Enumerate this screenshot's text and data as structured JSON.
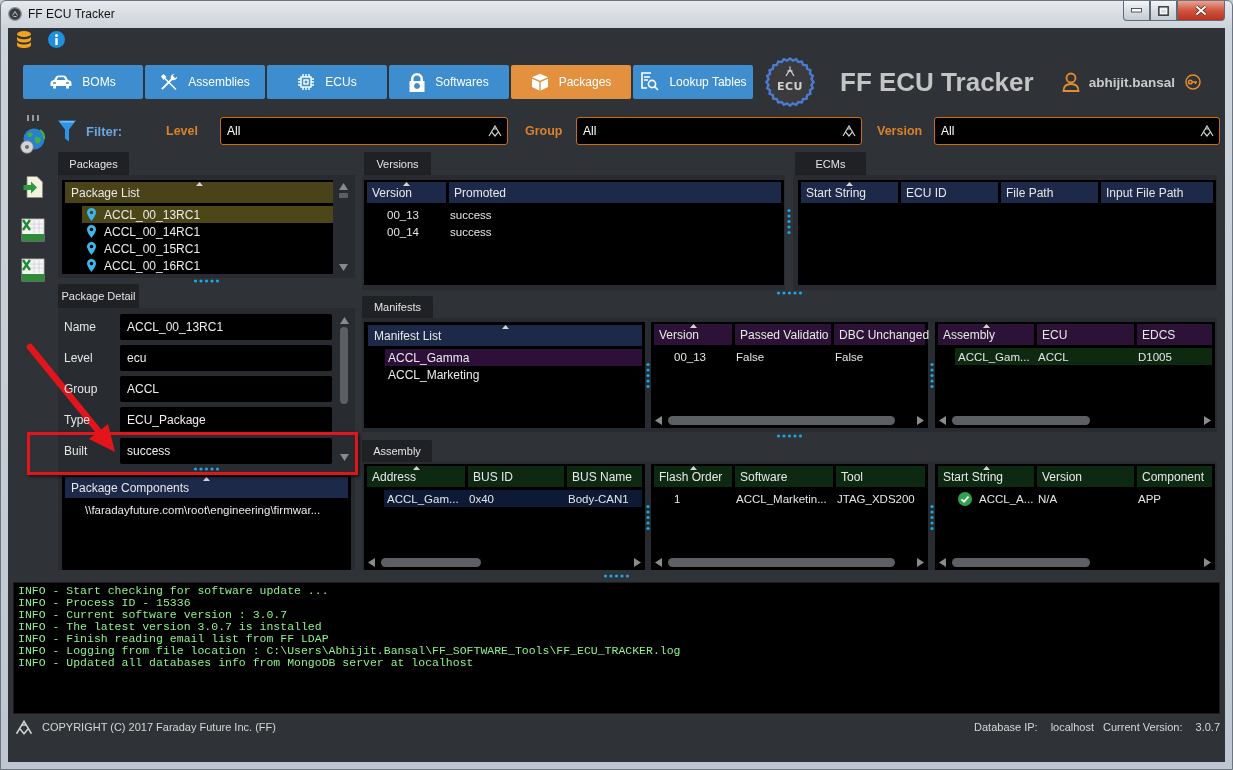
{
  "window": {
    "title": "FF ECU Tracker"
  },
  "nav_tabs": [
    {
      "label": "BOMs",
      "selected": false
    },
    {
      "label": "Assemblies",
      "selected": false
    },
    {
      "label": "ECUs",
      "selected": false
    },
    {
      "label": "Softwares",
      "selected": false
    },
    {
      "label": "Packages",
      "selected": true
    },
    {
      "label": "Lookup Tables",
      "selected": false
    }
  ],
  "logo": {
    "text": "ECU"
  },
  "app_title": "FF ECU Tracker",
  "user": {
    "name": "abhijit.bansal"
  },
  "filter": {
    "label": "Filter:",
    "fields": [
      {
        "label": "Level",
        "value": "All"
      },
      {
        "label": "Group",
        "value": "All"
      },
      {
        "label": "Version",
        "value": "All"
      }
    ]
  },
  "packages": {
    "tab": "Packages",
    "list": {
      "columns": [
        {
          "label": "Package List",
          "sorted": true
        }
      ],
      "items": [
        {
          "label": "ACCL_00_13RC1",
          "selected": true
        },
        {
          "label": "ACCL_00_14RC1",
          "selected": false
        },
        {
          "label": "ACCL_00_15RC1",
          "selected": false
        },
        {
          "label": "ACCL_00_16RC1",
          "selected": false
        }
      ]
    }
  },
  "package_detail": {
    "tab": "Package Detail",
    "fields": [
      {
        "label": "Name",
        "value": "ACCL_00_13RC1",
        "highlighted": false
      },
      {
        "label": "Level",
        "value": "ecu",
        "highlighted": false
      },
      {
        "label": "Group",
        "value": "ACCL",
        "highlighted": false
      },
      {
        "label": "Type",
        "value": "ECU_Package",
        "highlighted": false
      },
      {
        "label": "Built",
        "value": "success",
        "highlighted": true
      }
    ],
    "components": {
      "columns": [
        {
          "label": "Package Components",
          "sorted": true
        }
      ],
      "items": [
        "\\\\faradayfuture.com\\root\\engineering\\firmwar..."
      ]
    }
  },
  "versions": {
    "tab": "Versions",
    "table": {
      "columns": [
        {
          "label": "Version",
          "sorted": true
        },
        {
          "label": "Promoted",
          "sorted": false
        }
      ],
      "rows": [
        {
          "cells": [
            "00_13",
            "success"
          ],
          "selected": false
        },
        {
          "cells": [
            "00_14",
            "success"
          ],
          "selected": false
        }
      ]
    }
  },
  "ecms": {
    "tab": "ECMs",
    "table": {
      "columns": [
        {
          "label": "Start String",
          "sorted": true
        },
        {
          "label": "ECU ID",
          "sorted": false
        },
        {
          "label": "File Path",
          "sorted": false
        },
        {
          "label": "Input File Path",
          "sorted": false
        }
      ]
    }
  },
  "manifests": {
    "tab": "Manifests",
    "list": {
      "columns": [
        {
          "label": "Manifest List",
          "sorted": true
        }
      ],
      "items": [
        {
          "label": "ACCL_Gamma",
          "selected": true
        },
        {
          "label": "ACCL_Marketing",
          "selected": false
        }
      ]
    },
    "validation_table": {
      "columns": [
        {
          "label": "Version",
          "sorted": true
        },
        {
          "label": "Passed Validatio",
          "sorted": false
        },
        {
          "label": "DBC Unchanged",
          "sorted": false
        }
      ],
      "rows": [
        {
          "cells": [
            "00_13",
            "False",
            "False"
          ],
          "selected": false
        }
      ]
    },
    "assembly_table": {
      "columns": [
        {
          "label": "Assembly",
          "sorted": true
        },
        {
          "label": "ECU",
          "sorted": false
        },
        {
          "label": "EDCS",
          "sorted": false
        }
      ],
      "rows": [
        {
          "cells": [
            "ACCL_Gam...",
            "ACCL",
            "D1005"
          ],
          "selected": true
        }
      ]
    }
  },
  "assembly": {
    "tab": "Assembly",
    "bus_table": {
      "columns": [
        {
          "label": "Address",
          "sorted": true
        },
        {
          "label": "BUS ID",
          "sorted": false
        },
        {
          "label": "BUS Name",
          "sorted": false
        }
      ],
      "rows": [
        {
          "cells": [
            "ACCL_Gam...",
            "0x40",
            "Body-CAN1"
          ],
          "selected": true
        }
      ]
    },
    "flash_table": {
      "columns": [
        {
          "label": "Flash Order",
          "sorted": true
        },
        {
          "label": "Software",
          "sorted": false
        },
        {
          "label": "Tool",
          "sorted": false
        }
      ],
      "rows": [
        {
          "cells": [
            "1",
            "ACCL_Marketin...",
            "JTAG_XDS200"
          ],
          "selected": false
        }
      ]
    },
    "component_table": {
      "columns": [
        {
          "label": "Start String",
          "sorted": true
        },
        {
          "label": "Version",
          "sorted": false
        },
        {
          "label": "Component",
          "sorted": false
        }
      ],
      "rows": [
        {
          "cells": [
            "ACCL_A...",
            "N/A",
            "APP"
          ],
          "selected": false,
          "checked": true
        }
      ]
    }
  },
  "log": {
    "lines": [
      "INFO - Start checking for software update ...",
      "INFO - Process ID - 15336",
      "INFO - Current software version : 3.0.7",
      "INFO - The latest version 3.0.7 is installed",
      "INFO - Finish reading email list from FF LDAP",
      "INFO - Logging from file location : C:\\Users\\Abhijit.Bansal\\FF_SOFTWARE_Tools\\FF_ECU_TRACKER.log",
      "INFO - Updated all databases info from MongoDB server at localhost"
    ]
  },
  "status_bar": {
    "copyright": "COPYRIGHT (C) 2017 Faraday Future Inc. (FF)",
    "items": [
      {
        "label": "Database IP:",
        "value": "localhost"
      },
      {
        "label": "Current Version:",
        "value": "3.0.7"
      }
    ]
  }
}
